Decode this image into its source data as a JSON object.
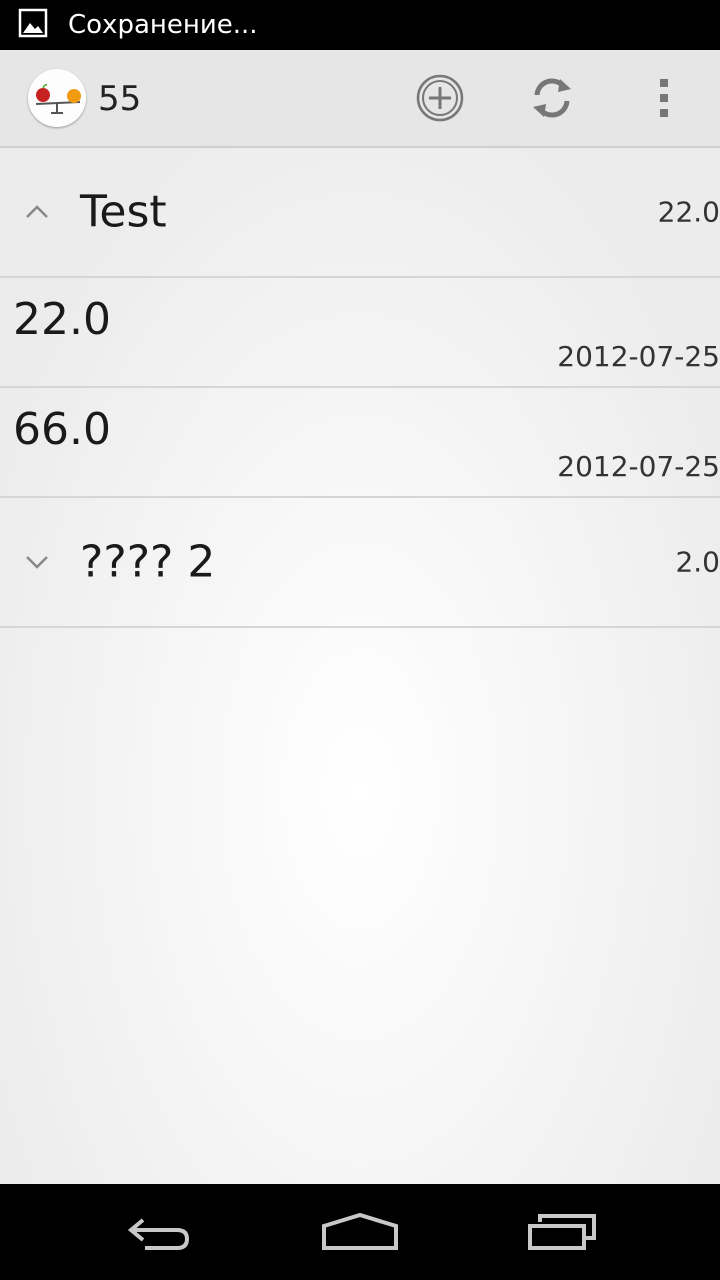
{
  "status_bar": {
    "notification_icon": "image-icon",
    "text": "Сохранение..."
  },
  "action_bar": {
    "app_icon": "scales-apple-orange-logo",
    "count": "55",
    "actions": [
      {
        "name": "add",
        "icon": "add-circle-icon"
      },
      {
        "name": "refresh",
        "icon": "refresh-icon"
      },
      {
        "name": "overflow",
        "icon": "overflow-menu-icon"
      }
    ]
  },
  "list": {
    "groups": [
      {
        "title": "Test",
        "total": "22.0",
        "expanded": true,
        "items": [
          {
            "value": "22.0",
            "date": "2012-07-25"
          },
          {
            "value": "66.0",
            "date": "2012-07-25"
          }
        ]
      },
      {
        "title": "???? 2",
        "total": "2.0",
        "expanded": false,
        "items": []
      }
    ]
  },
  "nav_bar": {
    "buttons": [
      "back-icon",
      "home-icon",
      "recent-apps-icon"
    ]
  },
  "colors": {
    "status_bar_bg": "#000000",
    "action_bar_bg": "#e6e6e6",
    "divider": "#d6d6d6",
    "nav_bar_bg": "#000000"
  }
}
